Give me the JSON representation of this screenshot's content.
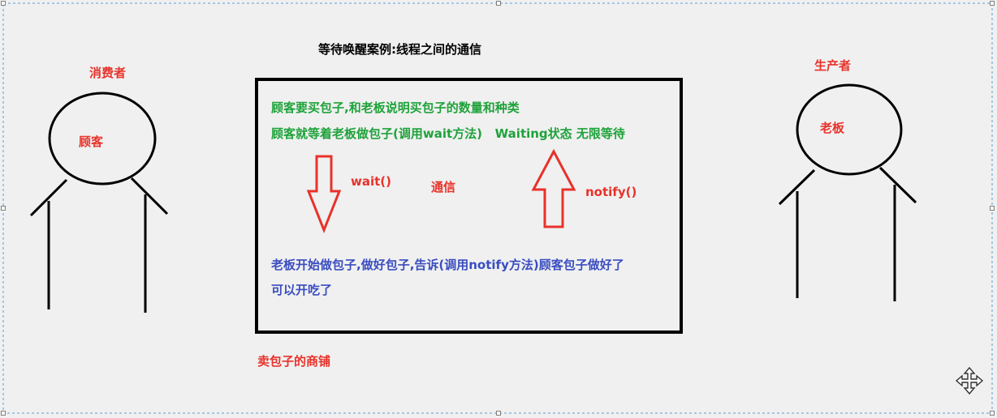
{
  "diagram": {
    "title": "等待唤醒案例:线程之间的通信",
    "consumer": {
      "role_label": "消费者",
      "name": "顾客"
    },
    "producer": {
      "role_label": "生产者",
      "name": "老板"
    },
    "shop": {
      "label": "卖包子的商铺",
      "line1": "顾客要买包子,和老板说明买包子的数量和种类",
      "line2": "顾客就等着老板做包子(调用wait方法)   Waiting状态 无限等待",
      "line3": "老板开始做包子,做好包子,告诉(调用notify方法)顾客包子做好了",
      "line4": "可以开吃了"
    },
    "arrows": {
      "wait_label": "wait()",
      "communication_label": "通信",
      "notify_label": "notify()"
    },
    "colors": {
      "red": "#e8322a",
      "green": "#1ea23a",
      "blue": "#3a4dc0",
      "black": "#000000",
      "selection_border": "#5b9bd5"
    },
    "icons": {
      "move_handle": "move-cross-arrows-icon"
    }
  }
}
